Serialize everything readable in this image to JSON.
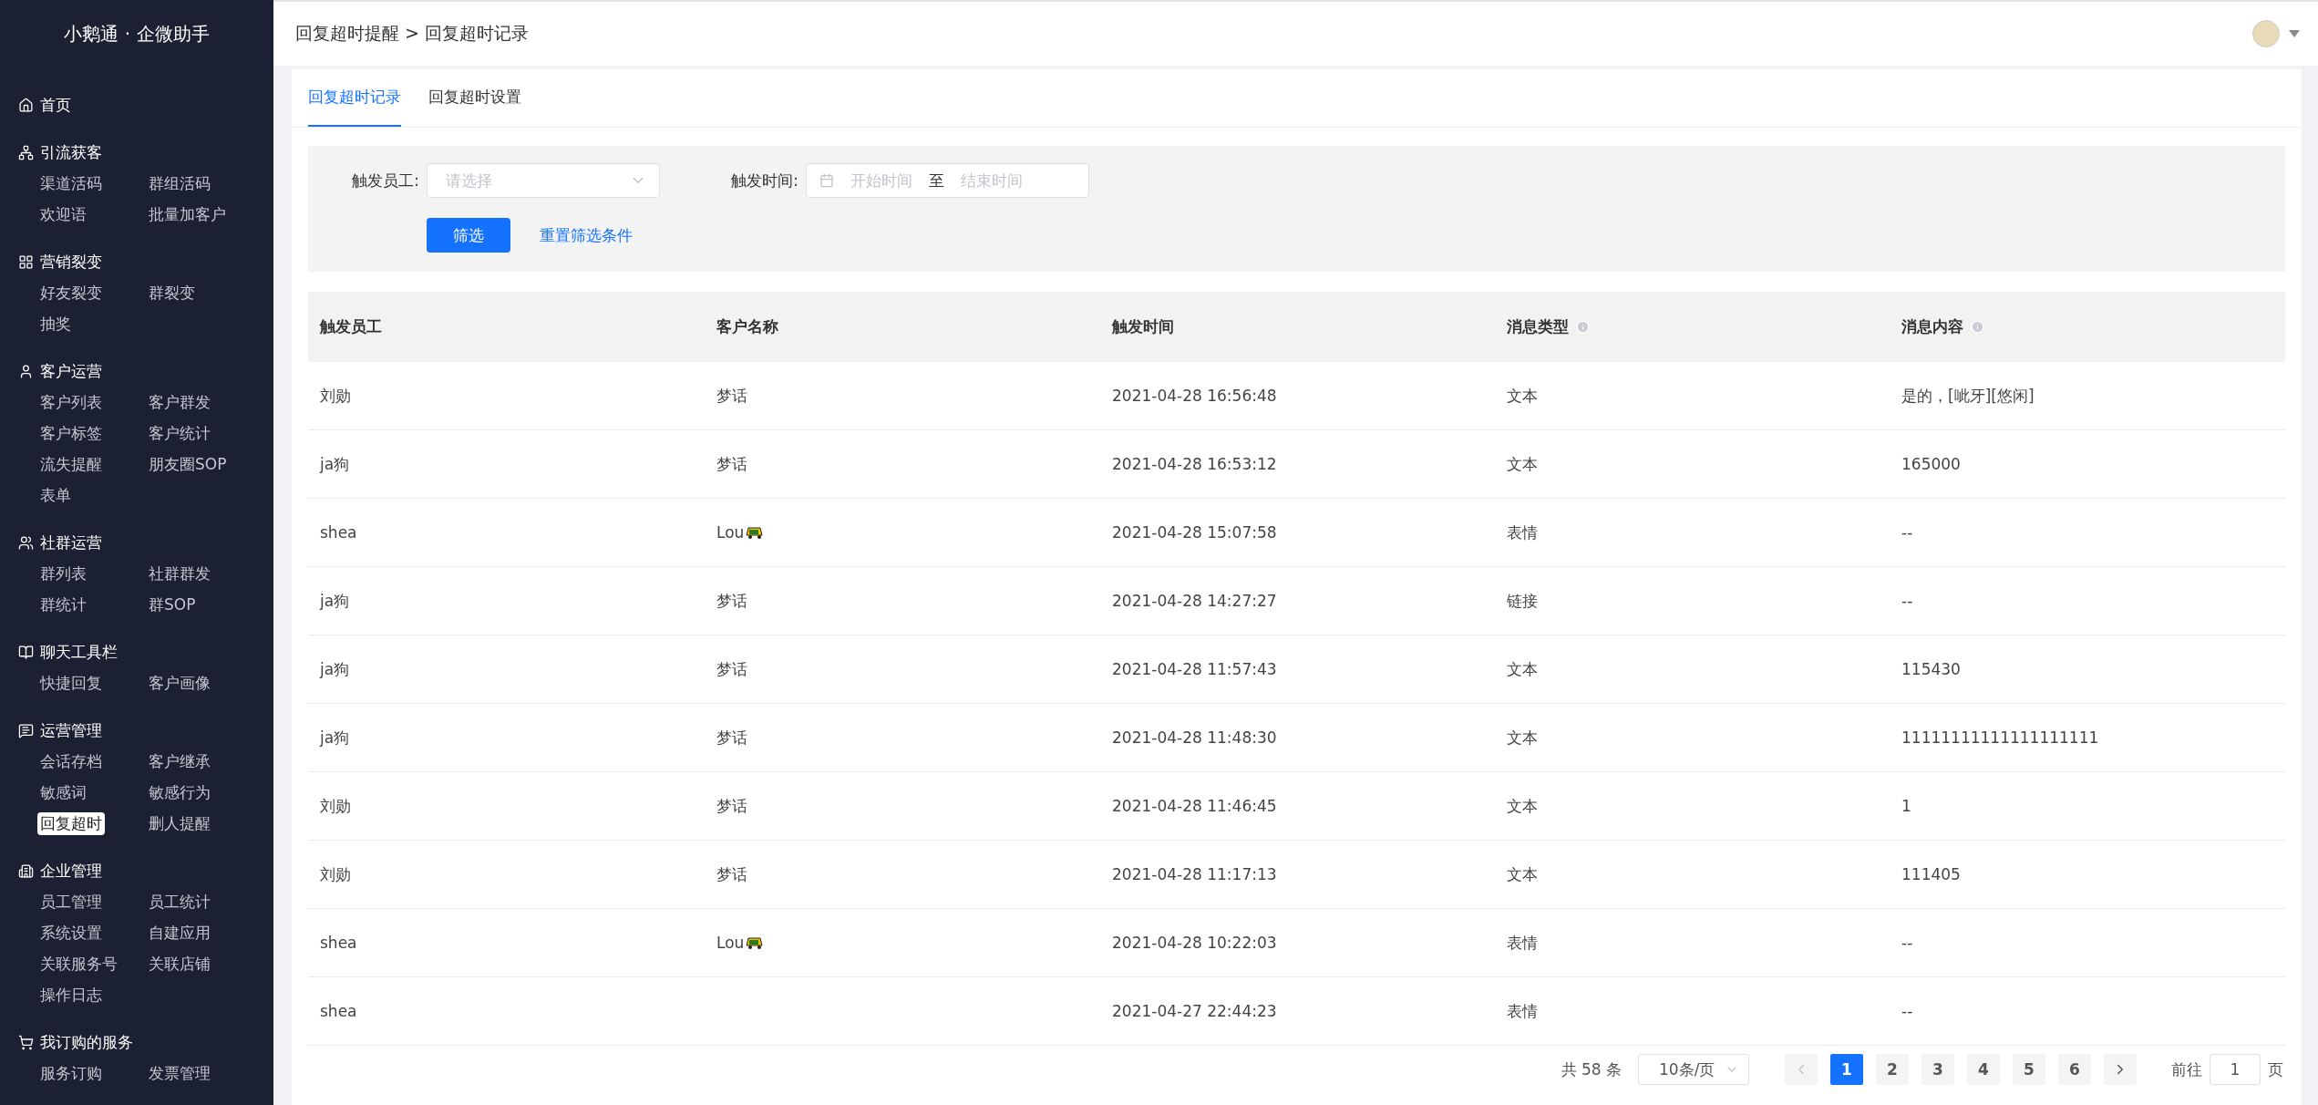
{
  "app": {
    "title": "小鹅通 · 企微助手"
  },
  "sidebar": {
    "groups": [
      {
        "label": "首页"
      },
      {
        "label": "引流获客",
        "items": [
          {
            "label": "渠道活码",
            "selected": false
          },
          {
            "label": "群组活码",
            "selected": false
          },
          {
            "label": "欢迎语",
            "selected": false
          },
          {
            "label": "批量加客户",
            "selected": false
          }
        ]
      },
      {
        "label": "营销裂变",
        "items": [
          {
            "label": "好友裂变",
            "selected": false
          },
          {
            "label": "群裂变",
            "selected": false
          },
          {
            "label": "抽奖",
            "selected": false
          }
        ]
      },
      {
        "label": "客户运营",
        "items": [
          {
            "label": "客户列表",
            "selected": false
          },
          {
            "label": "客户群发",
            "selected": false
          },
          {
            "label": "客户标签",
            "selected": false
          },
          {
            "label": "客户统计",
            "selected": false
          },
          {
            "label": "流失提醒",
            "selected": false
          },
          {
            "label": "朋友圈SOP",
            "selected": false
          },
          {
            "label": "表单",
            "selected": false
          }
        ]
      },
      {
        "label": "社群运营",
        "items": [
          {
            "label": "群列表",
            "selected": false
          },
          {
            "label": "社群群发",
            "selected": false
          },
          {
            "label": "群统计",
            "selected": false
          },
          {
            "label": "群SOP",
            "selected": false
          }
        ]
      },
      {
        "label": "聊天工具栏",
        "items": [
          {
            "label": "快捷回复",
            "selected": false
          },
          {
            "label": "客户画像",
            "selected": false
          }
        ]
      },
      {
        "label": "运营管理",
        "items": [
          {
            "label": "会话存档",
            "selected": false
          },
          {
            "label": "客户继承",
            "selected": false
          },
          {
            "label": "敏感词",
            "selected": false
          },
          {
            "label": "敏感行为",
            "selected": false
          },
          {
            "label": "回复超时",
            "selected": true
          },
          {
            "label": "删人提醒",
            "selected": false
          }
        ]
      },
      {
        "label": "企业管理",
        "items": [
          {
            "label": "员工管理",
            "selected": false
          },
          {
            "label": "员工统计",
            "selected": false
          },
          {
            "label": "系统设置",
            "selected": false
          },
          {
            "label": "自建应用",
            "selected": false
          },
          {
            "label": "关联服务号",
            "selected": false
          },
          {
            "label": "关联店铺",
            "selected": false
          },
          {
            "label": "操作日志",
            "selected": false
          }
        ]
      },
      {
        "label": "我订购的服务",
        "items": [
          {
            "label": "服务订购",
            "selected": false
          },
          {
            "label": "发票管理",
            "selected": false
          }
        ]
      }
    ]
  },
  "header": {
    "breadcrumb": "回复超时提醒 > 回复超时记录"
  },
  "tabs": [
    {
      "label": "回复超时记录",
      "selected": true
    },
    {
      "label": "回复超时设置",
      "selected": false
    }
  ],
  "filter": {
    "staff_label": "触发员工:",
    "staff_placeholder": "请选择",
    "time_label": "触发时间:",
    "start_placeholder": "开始时间",
    "range_separator": "至",
    "end_placeholder": "结束时间",
    "submit": "筛选",
    "reset": "重置筛选条件"
  },
  "table": {
    "columns": [
      {
        "label": "触发员工",
        "info": false
      },
      {
        "label": "客户名称",
        "info": false
      },
      {
        "label": "触发时间",
        "info": false
      },
      {
        "label": "消息类型",
        "info": true
      },
      {
        "label": "消息内容",
        "info": true
      }
    ],
    "rows": [
      {
        "staff": "刘勋",
        "customer": "梦话",
        "vehicle_icon": false,
        "time": "2021-04-28 16:56:48",
        "type": "文本",
        "content": "是的，[呲牙][悠闲]"
      },
      {
        "staff": "ja狗",
        "customer": "梦话",
        "vehicle_icon": false,
        "time": "2021-04-28 16:53:12",
        "type": "文本",
        "content": "165000"
      },
      {
        "staff": "shea",
        "customer": "Lou",
        "vehicle_icon": true,
        "time": "2021-04-28 15:07:58",
        "type": "表情",
        "content": "--"
      },
      {
        "staff": "ja狗",
        "customer": "梦话",
        "vehicle_icon": false,
        "time": "2021-04-28 14:27:27",
        "type": "链接",
        "content": "--"
      },
      {
        "staff": "ja狗",
        "customer": "梦话",
        "vehicle_icon": false,
        "time": "2021-04-28 11:57:43",
        "type": "文本",
        "content": "115430"
      },
      {
        "staff": "ja狗",
        "customer": "梦话",
        "vehicle_icon": false,
        "time": "2021-04-28 11:48:30",
        "type": "文本",
        "content": "11111111111111111111"
      },
      {
        "staff": "刘勋",
        "customer": "梦话",
        "vehicle_icon": false,
        "time": "2021-04-28 11:46:45",
        "type": "文本",
        "content": "1"
      },
      {
        "staff": "刘勋",
        "customer": "梦话",
        "vehicle_icon": false,
        "time": "2021-04-28 11:17:13",
        "type": "文本",
        "content": "111405"
      },
      {
        "staff": "shea",
        "customer": "Lou",
        "vehicle_icon": true,
        "time": "2021-04-28 10:22:03",
        "type": "表情",
        "content": "--"
      },
      {
        "staff": "shea",
        "vehicle_icon": false,
        "time": "2021-04-27 22:44:23",
        "type": "表情",
        "content": "--"
      }
    ]
  },
  "pagination": {
    "total": "共 58 条",
    "page_size": "10条/页",
    "prev_disabled": true,
    "next_disabled": false,
    "pages": [
      {
        "label": "1",
        "selected": true
      },
      {
        "label": "2",
        "selected": false
      },
      {
        "label": "3",
        "selected": false
      },
      {
        "label": "4",
        "selected": false
      },
      {
        "label": "5",
        "selected": false
      },
      {
        "label": "6",
        "selected": false
      }
    ],
    "goto_label": "前往",
    "goto_value": "1",
    "goto_suffix": "页"
  }
}
